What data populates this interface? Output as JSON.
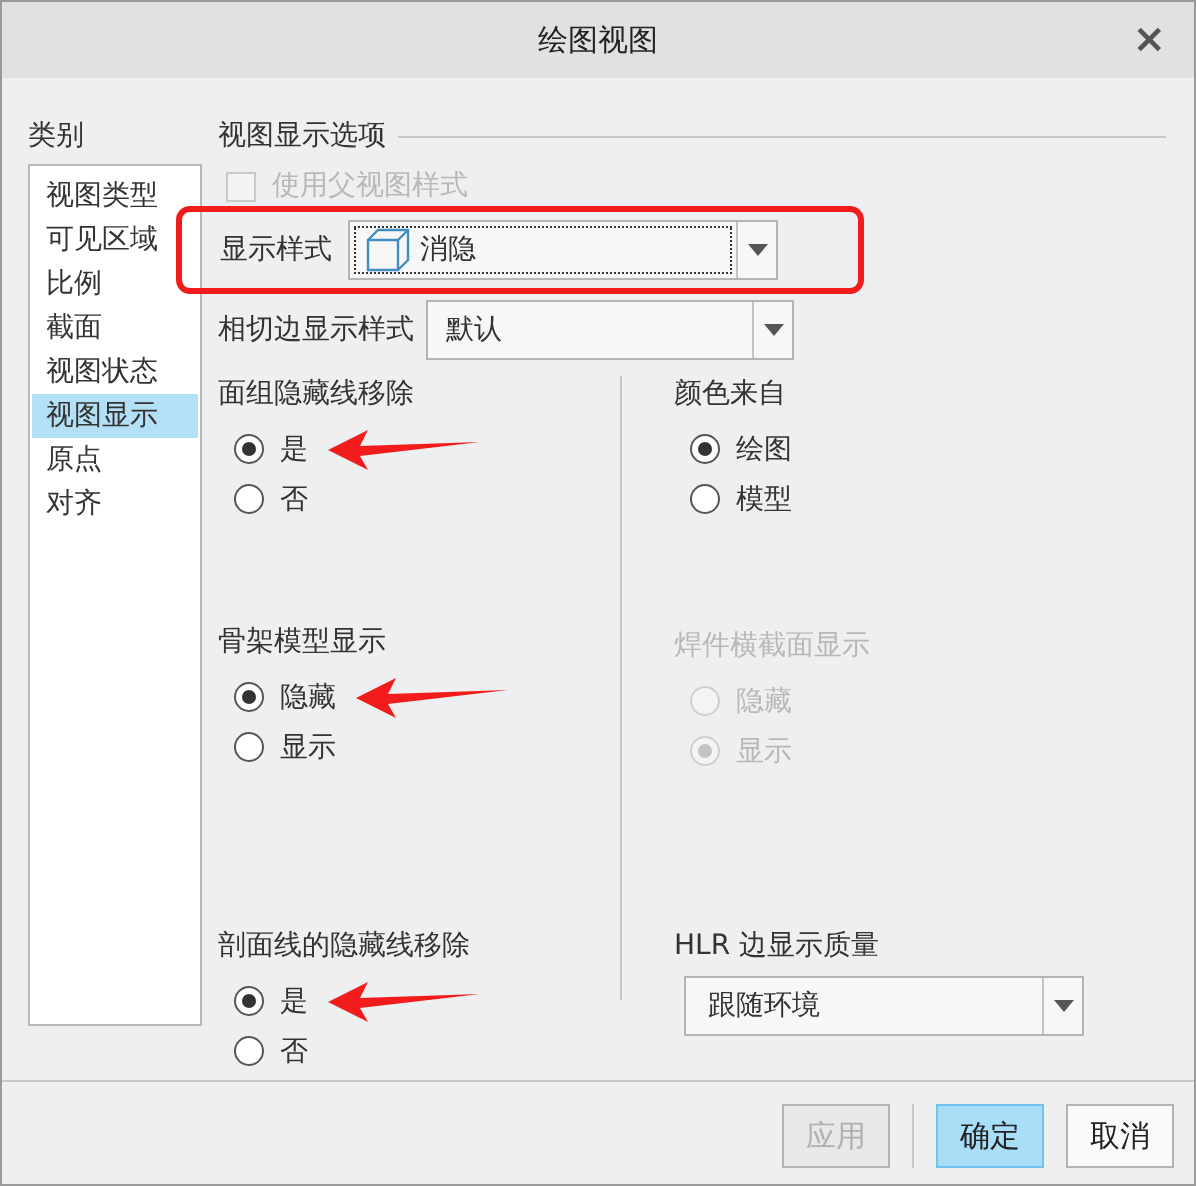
{
  "window": {
    "title": "绘图视图",
    "close": "×"
  },
  "categories": {
    "label": "类别",
    "items": [
      {
        "label": "视图类型",
        "selected": false
      },
      {
        "label": "可见区域",
        "selected": false
      },
      {
        "label": "比例",
        "selected": false
      },
      {
        "label": "截面",
        "selected": false
      },
      {
        "label": "视图状态",
        "selected": false
      },
      {
        "label": "视图显示",
        "selected": true
      },
      {
        "label": "原点",
        "selected": false
      },
      {
        "label": "对齐",
        "selected": false
      }
    ]
  },
  "options": {
    "title": "视图显示选项",
    "use_parent_style": {
      "label": "使用父视图样式",
      "checked": false,
      "disabled": true
    },
    "display_style": {
      "label": "显示样式",
      "value": "消隐",
      "highlighted": true
    },
    "tangent_style": {
      "label": "相切边显示样式",
      "value": "默认"
    },
    "left_groups": [
      {
        "title": "面组隐藏线移除",
        "disabled": false,
        "options": [
          {
            "label": "是",
            "selected": true,
            "annotated": true
          },
          {
            "label": "否",
            "selected": false,
            "annotated": false
          }
        ]
      },
      {
        "title": "骨架模型显示",
        "disabled": false,
        "options": [
          {
            "label": "隐藏",
            "selected": true,
            "annotated": true
          },
          {
            "label": "显示",
            "selected": false,
            "annotated": false
          }
        ]
      },
      {
        "title": "剖面线的隐藏线移除",
        "disabled": false,
        "options": [
          {
            "label": "是",
            "selected": true,
            "annotated": true
          },
          {
            "label": "否",
            "selected": false,
            "annotated": false
          }
        ]
      }
    ],
    "right_groups": [
      {
        "title": "颜色来自",
        "disabled": false,
        "options": [
          {
            "label": "绘图",
            "selected": true,
            "annotated": false
          },
          {
            "label": "模型",
            "selected": false,
            "annotated": false
          }
        ]
      },
      {
        "title": "焊件横截面显示",
        "disabled": true,
        "options": [
          {
            "label": "隐藏",
            "selected": false,
            "annotated": false
          },
          {
            "label": "显示",
            "selected": true,
            "annotated": false
          }
        ]
      }
    ],
    "hlr_quality": {
      "label": "HLR 边显示质量",
      "value": "跟随环境"
    }
  },
  "buttons": [
    {
      "label": "应用",
      "disabled": true,
      "primary": false
    },
    {
      "label": "确定",
      "disabled": false,
      "primary": true
    },
    {
      "label": "取消",
      "disabled": false,
      "primary": false
    }
  ]
}
